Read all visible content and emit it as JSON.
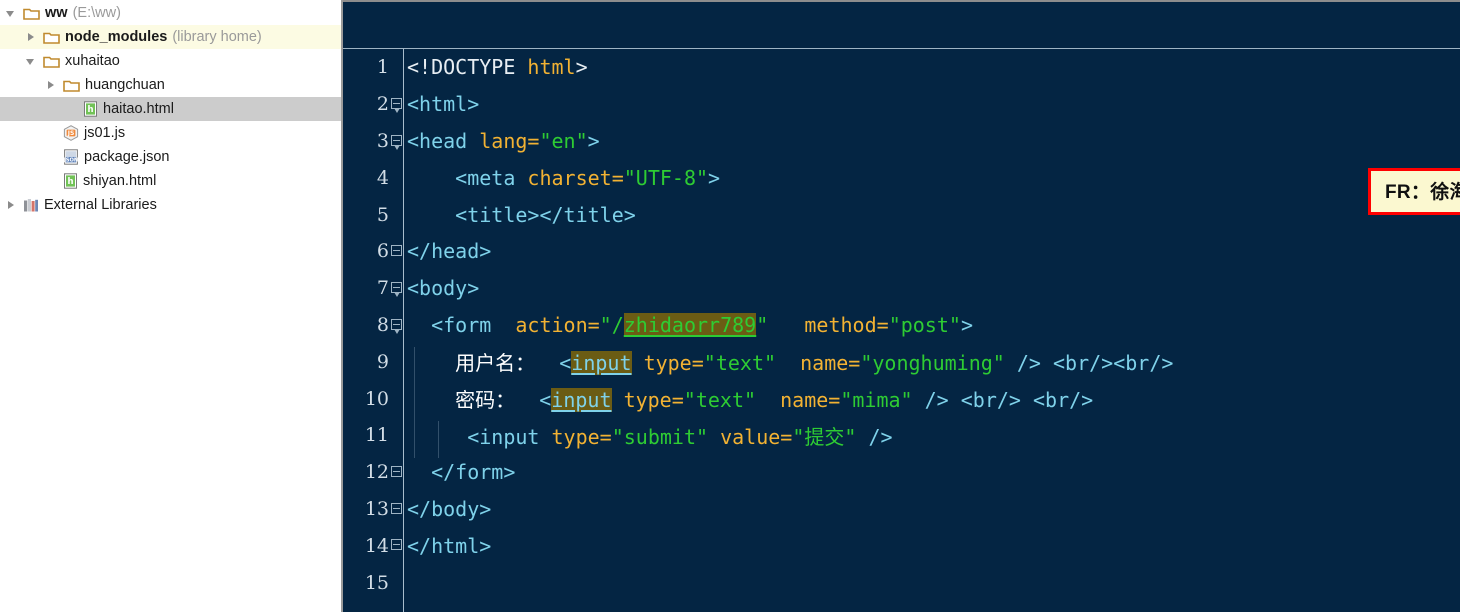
{
  "sidebar": {
    "items": [
      {
        "label": "ww",
        "suffix": "(E:\\ww)",
        "icon": "folder-icon",
        "twisty": "expanded",
        "indent": 0,
        "state": "normal",
        "bold": true
      },
      {
        "label": "node_modules",
        "suffix": "(library home)",
        "icon": "folder-icon",
        "twisty": "collapsed",
        "indent": 1,
        "state": "highlight-yellow",
        "bold": true
      },
      {
        "label": "xuhaitao",
        "suffix": "",
        "icon": "folder-icon",
        "twisty": "expanded",
        "indent": 1,
        "state": "normal",
        "bold": false
      },
      {
        "label": "huangchuan",
        "suffix": "",
        "icon": "folder-icon",
        "twisty": "collapsed",
        "indent": 2,
        "state": "normal",
        "bold": false
      },
      {
        "label": "haitao.html",
        "suffix": "",
        "icon": "html-file-icon",
        "twisty": "none",
        "indent": 3,
        "state": "selected",
        "bold": false
      },
      {
        "label": "js01.js",
        "suffix": "",
        "icon": "js-file-icon",
        "twisty": "none",
        "indent": 2,
        "state": "normal",
        "bold": false
      },
      {
        "label": "package.json",
        "suffix": "",
        "icon": "json-file-icon",
        "twisty": "none",
        "indent": 2,
        "state": "normal",
        "bold": false
      },
      {
        "label": "shiyan.html",
        "suffix": "",
        "icon": "html-file-icon",
        "twisty": "none",
        "indent": 2,
        "state": "normal",
        "bold": false
      },
      {
        "label": "External Libraries",
        "suffix": "",
        "icon": "books-icon",
        "twisty": "collapsed",
        "indent": 0,
        "state": "normal",
        "bold": false
      }
    ]
  },
  "editor": {
    "language": "html",
    "background_color": "#042543",
    "selection_color": "#6b5c14",
    "lines": [
      {
        "number": "1",
        "fold": false,
        "indent_guides": 0,
        "tokens": [
          {
            "text": "<!DOCTYPE ",
            "cls": "t-doct"
          },
          {
            "text": "html",
            "cls": "t-doctn"
          },
          {
            "text": ">",
            "cls": "t-doct"
          }
        ]
      },
      {
        "number": "2",
        "fold": true,
        "fold_pointy": true,
        "indent_guides": 0,
        "tokens": [
          {
            "text": "<html>",
            "cls": "t-tag"
          }
        ]
      },
      {
        "number": "3",
        "fold": true,
        "fold_pointy": true,
        "indent_guides": 0,
        "tokens": [
          {
            "text": "<head ",
            "cls": "t-tag"
          },
          {
            "text": "lang=",
            "cls": "t-attr"
          },
          {
            "text": "\"en\"",
            "cls": "t-str"
          },
          {
            "text": ">",
            "cls": "t-tag"
          }
        ]
      },
      {
        "number": "4",
        "fold": false,
        "indent_guides": 0,
        "tokens": [
          {
            "text": "    <meta ",
            "cls": "t-tag"
          },
          {
            "text": "charset=",
            "cls": "t-attr"
          },
          {
            "text": "\"UTF-8\"",
            "cls": "t-str"
          },
          {
            "text": ">",
            "cls": "t-tag"
          }
        ]
      },
      {
        "number": "5",
        "fold": false,
        "indent_guides": 0,
        "tokens": [
          {
            "text": "    <title></title>",
            "cls": "t-tag"
          }
        ]
      },
      {
        "number": "6",
        "fold": true,
        "fold_pointy": false,
        "indent_guides": 0,
        "tokens": [
          {
            "text": "</head>",
            "cls": "t-tag"
          }
        ]
      },
      {
        "number": "7",
        "fold": true,
        "fold_pointy": true,
        "indent_guides": 0,
        "tokens": [
          {
            "text": "<body>",
            "cls": "t-tag"
          }
        ]
      },
      {
        "number": "8",
        "fold": true,
        "fold_pointy": true,
        "indent_guides": 0,
        "tokens": [
          {
            "text": "  <form  ",
            "cls": "t-tag"
          },
          {
            "text": "action=",
            "cls": "t-attr"
          },
          {
            "text": "\"/",
            "cls": "t-str"
          },
          {
            "text": "zhidaorr789",
            "cls": "t-str",
            "selected": true
          },
          {
            "text": "\"",
            "cls": "t-str"
          },
          {
            "text": "   ",
            "cls": "t-plain"
          },
          {
            "text": "method=",
            "cls": "t-attr"
          },
          {
            "text": "\"post\"",
            "cls": "t-str"
          },
          {
            "text": ">",
            "cls": "t-tag"
          }
        ]
      },
      {
        "number": "9",
        "fold": false,
        "indent_guides": 1,
        "tokens": [
          {
            "text": "    ",
            "cls": "t-plain"
          },
          {
            "text": "用户名：",
            "cls": "t-cn"
          },
          {
            "text": "  <",
            "cls": "t-tag"
          },
          {
            "text": "input",
            "cls": "t-tag",
            "selected": true
          },
          {
            "text": " ",
            "cls": "t-plain"
          },
          {
            "text": "type=",
            "cls": "t-attr"
          },
          {
            "text": "\"text\"",
            "cls": "t-str"
          },
          {
            "text": "  ",
            "cls": "t-plain"
          },
          {
            "text": "name=",
            "cls": "t-attr"
          },
          {
            "text": "\"yonghuming\"",
            "cls": "t-str"
          },
          {
            "text": " /> ",
            "cls": "t-tag"
          },
          {
            "text": "<br/><br/>",
            "cls": "t-tag"
          }
        ]
      },
      {
        "number": "10",
        "fold": false,
        "indent_guides": 1,
        "tokens": [
          {
            "text": "    ",
            "cls": "t-plain"
          },
          {
            "text": "密码：",
            "cls": "t-cn"
          },
          {
            "text": "  <",
            "cls": "t-tag"
          },
          {
            "text": "input",
            "cls": "t-tag",
            "selected": true
          },
          {
            "text": " ",
            "cls": "t-plain"
          },
          {
            "text": "type=",
            "cls": "t-attr"
          },
          {
            "text": "\"text\"",
            "cls": "t-str"
          },
          {
            "text": "  ",
            "cls": "t-plain"
          },
          {
            "text": "name=",
            "cls": "t-attr"
          },
          {
            "text": "\"mima\"",
            "cls": "t-str"
          },
          {
            "text": " /> ",
            "cls": "t-tag"
          },
          {
            "text": "<br/> <br/>",
            "cls": "t-tag"
          }
        ]
      },
      {
        "number": "11",
        "fold": false,
        "indent_guides": 2,
        "tokens": [
          {
            "text": "     <input ",
            "cls": "t-tag"
          },
          {
            "text": "type=",
            "cls": "t-attr"
          },
          {
            "text": "\"submit\"",
            "cls": "t-str"
          },
          {
            "text": " ",
            "cls": "t-plain"
          },
          {
            "text": "value=",
            "cls": "t-attr"
          },
          {
            "text": "\"提交\"",
            "cls": "t-str"
          },
          {
            "text": " />",
            "cls": "t-tag"
          }
        ]
      },
      {
        "number": "12",
        "fold": true,
        "fold_pointy": false,
        "indent_guides": 0,
        "tokens": [
          {
            "text": "  </form>",
            "cls": "t-tag"
          }
        ]
      },
      {
        "number": "13",
        "fold": true,
        "fold_pointy": false,
        "indent_guides": 0,
        "tokens": [
          {
            "text": "</body>",
            "cls": "t-tag"
          }
        ]
      },
      {
        "number": "14",
        "fold": true,
        "fold_pointy": false,
        "indent_guides": 0,
        "tokens": [
          {
            "text": "</html>",
            "cls": "t-tag"
          }
        ]
      },
      {
        "number": "15",
        "fold": false,
        "indent_guides": 0,
        "tokens": [
          {
            "text": "",
            "cls": "t-plain"
          }
        ]
      }
    ]
  },
  "annotation": {
    "text": "FR：徐海涛（Hunk Xu)",
    "border_color": "#ff0000",
    "background_color": "#fbf8d0"
  }
}
